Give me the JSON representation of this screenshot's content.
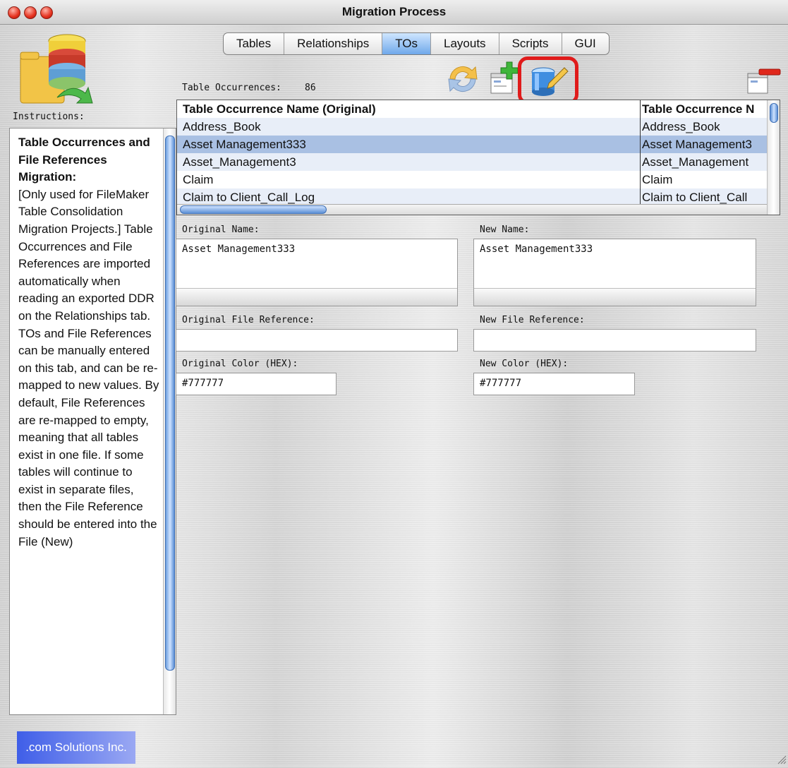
{
  "window": {
    "title": "Migration Process"
  },
  "tabs": [
    {
      "label": "Tables"
    },
    {
      "label": "Relationships"
    },
    {
      "label": "TOs"
    },
    {
      "label": "Layouts"
    },
    {
      "label": "Scripts"
    },
    {
      "label": "GUI"
    }
  ],
  "active_tab": "TOs",
  "counter": {
    "label": "Table Occurrences:",
    "value": "86"
  },
  "table": {
    "headers": [
      "Table Occurrence Name (Original)",
      "Table Occurrence N"
    ],
    "rows": [
      [
        "Address_Book",
        "Address_Book"
      ],
      [
        "Asset Management333",
        "Asset Management3"
      ],
      [
        "Asset_Management3",
        "Asset_Management"
      ],
      [
        "Claim",
        "Claim"
      ],
      [
        "Claim to Client_Call_Log",
        "Claim to Client_Call"
      ]
    ],
    "selected_row": 1
  },
  "form": {
    "original_name_label": "Original Name:",
    "original_name_value": "Asset Management333",
    "new_name_label": "New Name:",
    "new_name_value": "Asset Management333",
    "original_file_ref_label": "Original File Reference:",
    "original_file_ref_value": "",
    "new_file_ref_label": "New File Reference:",
    "new_file_ref_value": "",
    "original_color_label": "Original Color (HEX):",
    "original_color_value": "#777777",
    "new_color_label": "New Color (HEX):",
    "new_color_value": "#777777"
  },
  "instructions": {
    "label": "Instructions:",
    "title": "Table Occurrences and File References Migration:",
    "body": "[Only used for FileMaker Table Consolidation Migration Projects.] Table Occurrences and File References are imported automatically when reading an exported DDR on the Relationships tab. TOs and File References can be manually entered on this tab, and can be re-mapped to new values. By default, File References are re-mapped to empty, meaning that all tables exist in one file. If some tables will continue to exist in separate files, then the File Reference should be entered into the File (New)"
  },
  "footer": {
    "brand": ".com Solutions Inc."
  },
  "icons": {
    "app": "database-folder-icon",
    "refresh": "refresh-icon",
    "add_layout": "add-layout-icon",
    "edit_database": "edit-database-icon",
    "delete_layout": "delete-layout-icon"
  },
  "colors": {
    "selection": "#a9c0e3",
    "row_alt": "#e8eef8",
    "active_tab": "#6fa8ea",
    "highlight_box": "#e01b1b",
    "brand": "#3f5ee8"
  }
}
